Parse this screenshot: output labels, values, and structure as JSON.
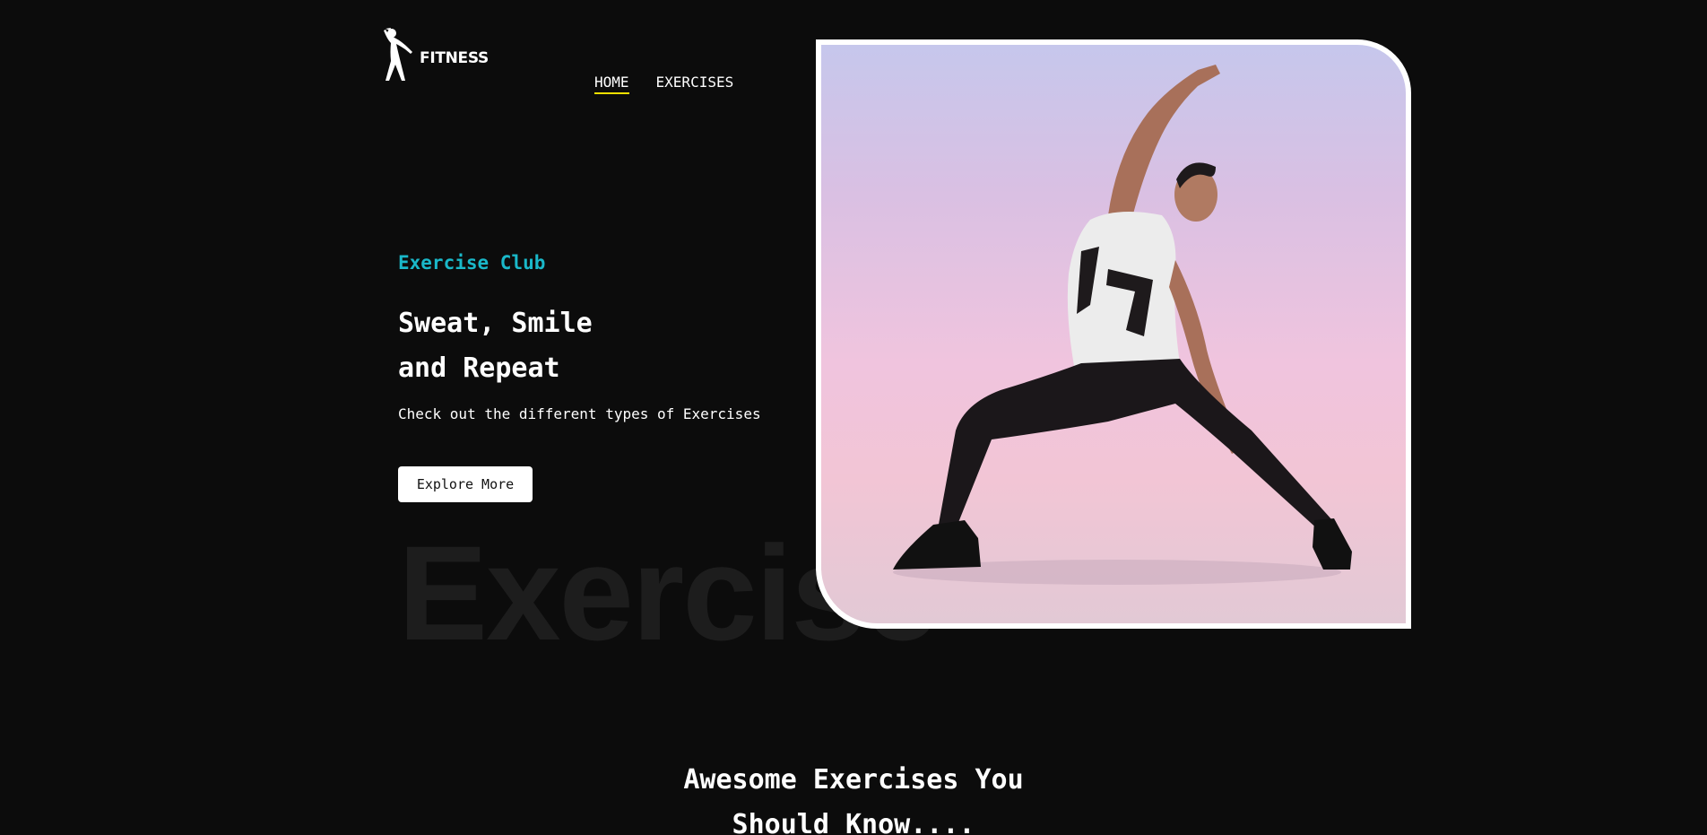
{
  "brand": {
    "logo_text": "FITNESS",
    "logo_icon": "stretching-figure-icon"
  },
  "nav": {
    "items": [
      {
        "label": "HOME",
        "active": true
      },
      {
        "label": "EXERCISES",
        "active": false
      }
    ],
    "active_underline_color": "#f4e000"
  },
  "hero": {
    "eyebrow": "Exercise Club",
    "title_line1": "Sweat, Smile",
    "title_line2": "and Repeat",
    "subtitle": "Check out the different types of Exercises",
    "cta_label": "Explore More",
    "watermark": "Exercise",
    "accent_color": "#1ab8c9"
  },
  "section": {
    "title_line1": "Awesome Exercises You",
    "title_line2": "Should Know...."
  },
  "colors": {
    "background": "#0c0c0c",
    "text": "#ffffff"
  }
}
